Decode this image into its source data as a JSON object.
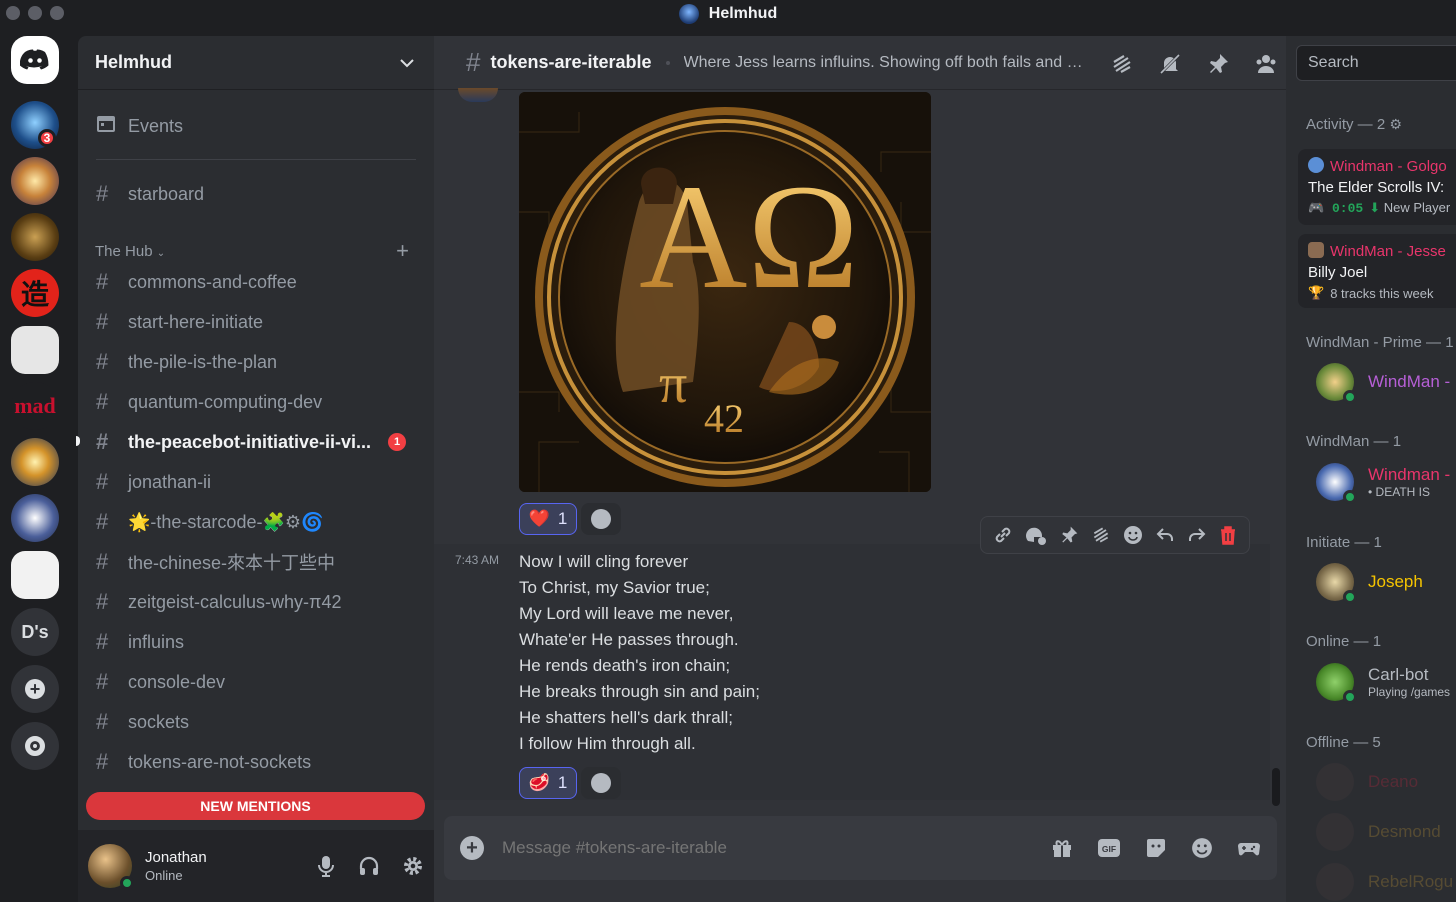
{
  "window": {
    "title": "Helmhud"
  },
  "servers": {
    "badge": "3",
    "dm_label": "D's"
  },
  "sidebar": {
    "server_name": "Helmhud",
    "events_label": "Events",
    "top_channel": "starboard",
    "category": "The Hub",
    "channels": [
      {
        "name": "commons-and-coffee"
      },
      {
        "name": "start-here-initiate"
      },
      {
        "name": "the-pile-is-the-plan"
      },
      {
        "name": "quantum-computing-dev"
      },
      {
        "name": "the-peacebot-initiative-ii-vi...",
        "unread": true,
        "badge": "1"
      },
      {
        "name": "jonathan-ii"
      },
      {
        "name": "🌟-the-starcode-🧩⚙🌀"
      },
      {
        "name": "the-chinese-來本十丁些中"
      },
      {
        "name": "zeitgeist-calculus-why-π42"
      },
      {
        "name": "influins"
      },
      {
        "name": "console-dev"
      },
      {
        "name": "sockets"
      },
      {
        "name": "tokens-are-not-sockets"
      }
    ],
    "new_mentions": "NEW MENTIONS"
  },
  "user": {
    "name": "Jonathan",
    "status": "Online"
  },
  "chat": {
    "channel": "tokens-are-iterable",
    "topic": "Where Jess learns influins. Showing off both fails and s...",
    "image_letters": "AΩ",
    "image_pi": "π",
    "image_num": "42",
    "reaction1": {
      "emoji": "❤️",
      "count": "1"
    },
    "reaction2": {
      "emoji": "🥩",
      "count": "1"
    },
    "message": {
      "time": "7:43 AM",
      "lines": [
        "Now I will cling forever",
        "To Christ, my Savior true;",
        "My Lord will leave me never,",
        "Whate'er He passes through.",
        "He rends death's iron chain;",
        "He breaks through sin and pain;",
        "He shatters hell's dark thrall;",
        "I follow Him through all."
      ]
    },
    "composer_placeholder": "Message #tokens-are-iterable"
  },
  "search": {
    "placeholder": "Search"
  },
  "members": {
    "activity_header": "Activity — 2",
    "activity": [
      {
        "title": "Windman - Golgo",
        "game": "The Elder Scrolls IV:",
        "time": "0:05",
        "extra": "New Player"
      },
      {
        "title": "WindMan - Jesse",
        "game": "Billy Joel",
        "extra": "8 tracks this week"
      }
    ],
    "groups": [
      {
        "header": "WindMan - Prime — 1",
        "members": [
          {
            "name": "WindMan -",
            "color": "#b65fd6"
          }
        ]
      },
      {
        "header": "WindMan — 1",
        "members": [
          {
            "name": "Windman -",
            "color": "#e8356b",
            "status": "• DEATH IS"
          }
        ]
      },
      {
        "header": "Initiate — 1",
        "members": [
          {
            "name": "Joseph",
            "color": "#f5c400"
          }
        ]
      },
      {
        "header": "Online — 1",
        "members": [
          {
            "name": "Carl-bot",
            "color": "#b5bac1",
            "status": "Playing /games"
          }
        ]
      },
      {
        "header": "Offline — 5",
        "members": [
          {
            "name": "Deano",
            "color": "#7a2a3a"
          },
          {
            "name": "Desmond",
            "color": "#7a6534"
          },
          {
            "name": "RebelRogu",
            "color": "#7a6534"
          }
        ]
      }
    ]
  }
}
